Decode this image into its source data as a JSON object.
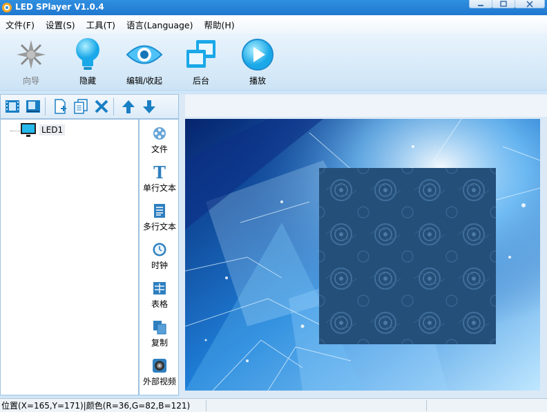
{
  "window": {
    "title": "LED SPlayer V1.0.4"
  },
  "menu": [
    {
      "label": "文件(F)"
    },
    {
      "label": "设置(S)"
    },
    {
      "label": "工具(T)"
    },
    {
      "label": "语言(Language)"
    },
    {
      "label": "帮助(H)"
    }
  ],
  "toolbar": {
    "wizard": "向导",
    "hide": "隐藏",
    "edit": "编辑/收起",
    "background": "后台",
    "play": "播放"
  },
  "tree": {
    "node": "LED1"
  },
  "add_items": [
    {
      "label": "文件",
      "icon": "film-reel-icon"
    },
    {
      "label": "单行文本",
      "icon": "text-t-icon"
    },
    {
      "label": "多行文本",
      "icon": "document-lines-icon"
    },
    {
      "label": "时钟",
      "icon": "clock-icon"
    },
    {
      "label": "表格",
      "icon": "table-icon"
    },
    {
      "label": "复制",
      "icon": "copy-icon"
    },
    {
      "label": "外部视频",
      "icon": "video-icon"
    }
  ],
  "status": {
    "text": "位置(X=165,Y=171)|颜色(R=36,G=82,B=121)"
  },
  "colors": {
    "accent": "#1f78cf",
    "window_fill": "#244f79"
  }
}
